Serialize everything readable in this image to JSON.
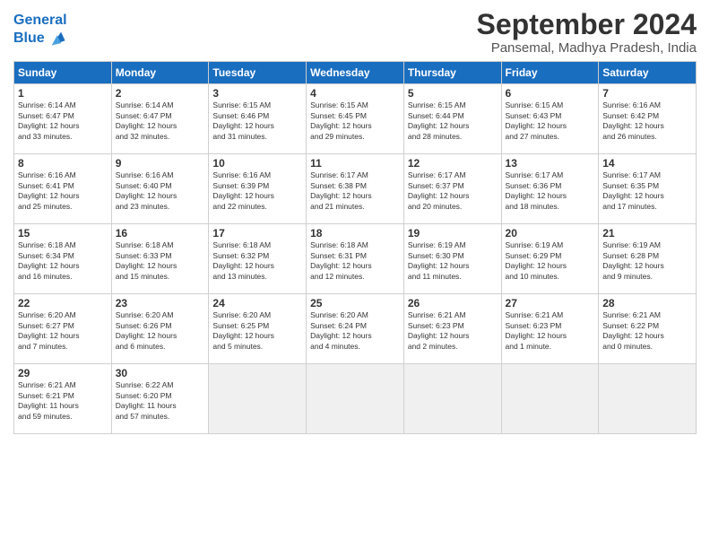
{
  "header": {
    "logo_line1": "General",
    "logo_line2": "Blue",
    "title": "September 2024",
    "location": "Pansemal, Madhya Pradesh, India"
  },
  "days_of_week": [
    "Sunday",
    "Monday",
    "Tuesday",
    "Wednesday",
    "Thursday",
    "Friday",
    "Saturday"
  ],
  "weeks": [
    [
      {
        "day": "1",
        "lines": [
          "Sunrise: 6:14 AM",
          "Sunset: 6:47 PM",
          "Daylight: 12 hours",
          "and 33 minutes."
        ]
      },
      {
        "day": "2",
        "lines": [
          "Sunrise: 6:14 AM",
          "Sunset: 6:47 PM",
          "Daylight: 12 hours",
          "and 32 minutes."
        ]
      },
      {
        "day": "3",
        "lines": [
          "Sunrise: 6:15 AM",
          "Sunset: 6:46 PM",
          "Daylight: 12 hours",
          "and 31 minutes."
        ]
      },
      {
        "day": "4",
        "lines": [
          "Sunrise: 6:15 AM",
          "Sunset: 6:45 PM",
          "Daylight: 12 hours",
          "and 29 minutes."
        ]
      },
      {
        "day": "5",
        "lines": [
          "Sunrise: 6:15 AM",
          "Sunset: 6:44 PM",
          "Daylight: 12 hours",
          "and 28 minutes."
        ]
      },
      {
        "day": "6",
        "lines": [
          "Sunrise: 6:15 AM",
          "Sunset: 6:43 PM",
          "Daylight: 12 hours",
          "and 27 minutes."
        ]
      },
      {
        "day": "7",
        "lines": [
          "Sunrise: 6:16 AM",
          "Sunset: 6:42 PM",
          "Daylight: 12 hours",
          "and 26 minutes."
        ]
      }
    ],
    [
      {
        "day": "8",
        "lines": [
          "Sunrise: 6:16 AM",
          "Sunset: 6:41 PM",
          "Daylight: 12 hours",
          "and 25 minutes."
        ]
      },
      {
        "day": "9",
        "lines": [
          "Sunrise: 6:16 AM",
          "Sunset: 6:40 PM",
          "Daylight: 12 hours",
          "and 23 minutes."
        ]
      },
      {
        "day": "10",
        "lines": [
          "Sunrise: 6:16 AM",
          "Sunset: 6:39 PM",
          "Daylight: 12 hours",
          "and 22 minutes."
        ]
      },
      {
        "day": "11",
        "lines": [
          "Sunrise: 6:17 AM",
          "Sunset: 6:38 PM",
          "Daylight: 12 hours",
          "and 21 minutes."
        ]
      },
      {
        "day": "12",
        "lines": [
          "Sunrise: 6:17 AM",
          "Sunset: 6:37 PM",
          "Daylight: 12 hours",
          "and 20 minutes."
        ]
      },
      {
        "day": "13",
        "lines": [
          "Sunrise: 6:17 AM",
          "Sunset: 6:36 PM",
          "Daylight: 12 hours",
          "and 18 minutes."
        ]
      },
      {
        "day": "14",
        "lines": [
          "Sunrise: 6:17 AM",
          "Sunset: 6:35 PM",
          "Daylight: 12 hours",
          "and 17 minutes."
        ]
      }
    ],
    [
      {
        "day": "15",
        "lines": [
          "Sunrise: 6:18 AM",
          "Sunset: 6:34 PM",
          "Daylight: 12 hours",
          "and 16 minutes."
        ]
      },
      {
        "day": "16",
        "lines": [
          "Sunrise: 6:18 AM",
          "Sunset: 6:33 PM",
          "Daylight: 12 hours",
          "and 15 minutes."
        ]
      },
      {
        "day": "17",
        "lines": [
          "Sunrise: 6:18 AM",
          "Sunset: 6:32 PM",
          "Daylight: 12 hours",
          "and 13 minutes."
        ]
      },
      {
        "day": "18",
        "lines": [
          "Sunrise: 6:18 AM",
          "Sunset: 6:31 PM",
          "Daylight: 12 hours",
          "and 12 minutes."
        ]
      },
      {
        "day": "19",
        "lines": [
          "Sunrise: 6:19 AM",
          "Sunset: 6:30 PM",
          "Daylight: 12 hours",
          "and 11 minutes."
        ]
      },
      {
        "day": "20",
        "lines": [
          "Sunrise: 6:19 AM",
          "Sunset: 6:29 PM",
          "Daylight: 12 hours",
          "and 10 minutes."
        ]
      },
      {
        "day": "21",
        "lines": [
          "Sunrise: 6:19 AM",
          "Sunset: 6:28 PM",
          "Daylight: 12 hours",
          "and 9 minutes."
        ]
      }
    ],
    [
      {
        "day": "22",
        "lines": [
          "Sunrise: 6:20 AM",
          "Sunset: 6:27 PM",
          "Daylight: 12 hours",
          "and 7 minutes."
        ]
      },
      {
        "day": "23",
        "lines": [
          "Sunrise: 6:20 AM",
          "Sunset: 6:26 PM",
          "Daylight: 12 hours",
          "and 6 minutes."
        ]
      },
      {
        "day": "24",
        "lines": [
          "Sunrise: 6:20 AM",
          "Sunset: 6:25 PM",
          "Daylight: 12 hours",
          "and 5 minutes."
        ]
      },
      {
        "day": "25",
        "lines": [
          "Sunrise: 6:20 AM",
          "Sunset: 6:24 PM",
          "Daylight: 12 hours",
          "and 4 minutes."
        ]
      },
      {
        "day": "26",
        "lines": [
          "Sunrise: 6:21 AM",
          "Sunset: 6:23 PM",
          "Daylight: 12 hours",
          "and 2 minutes."
        ]
      },
      {
        "day": "27",
        "lines": [
          "Sunrise: 6:21 AM",
          "Sunset: 6:23 PM",
          "Daylight: 12 hours",
          "and 1 minute."
        ]
      },
      {
        "day": "28",
        "lines": [
          "Sunrise: 6:21 AM",
          "Sunset: 6:22 PM",
          "Daylight: 12 hours",
          "and 0 minutes."
        ]
      }
    ],
    [
      {
        "day": "29",
        "lines": [
          "Sunrise: 6:21 AM",
          "Sunset: 6:21 PM",
          "Daylight: 11 hours",
          "and 59 minutes."
        ]
      },
      {
        "day": "30",
        "lines": [
          "Sunrise: 6:22 AM",
          "Sunset: 6:20 PM",
          "Daylight: 11 hours",
          "and 57 minutes."
        ]
      },
      {
        "day": "",
        "lines": []
      },
      {
        "day": "",
        "lines": []
      },
      {
        "day": "",
        "lines": []
      },
      {
        "day": "",
        "lines": []
      },
      {
        "day": "",
        "lines": []
      }
    ]
  ]
}
